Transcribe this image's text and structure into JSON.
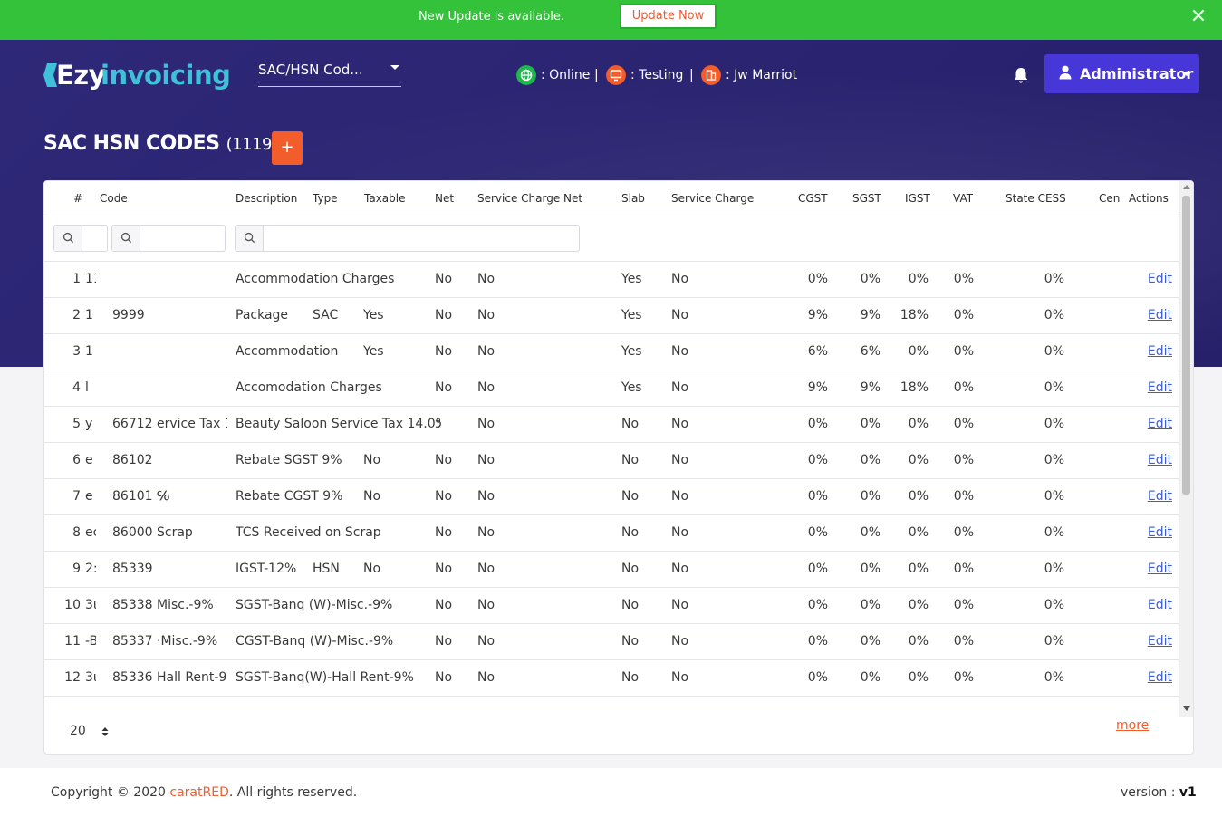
{
  "banner": {
    "message": "New Update is available.",
    "button_label": "Update Now",
    "close_glyph": "✕",
    "close_icon": "close-icon"
  },
  "header": {
    "logo_part1": "Ezy",
    "logo_part2": "invoicing",
    "module_select": "SAC/HSN Cod...",
    "status": [
      {
        "label": ": Online",
        "icon": "globe-icon",
        "color": "#1fb84b"
      },
      {
        "label": ": Testing",
        "icon": "monitor-icon",
        "color": "#f25d2b"
      },
      {
        "label": ": Jw Marriot",
        "icon": "building-icon",
        "color": "#f25d2b"
      }
    ],
    "separator": "|",
    "user_label": "Administrator",
    "bell_icon": "bell-icon"
  },
  "page": {
    "title": "SAC HSN CODES",
    "count": "(1119)",
    "add_glyph": "+"
  },
  "table": {
    "columns": [
      "#",
      "Code",
      "Description",
      "Type",
      "Taxable",
      "Net",
      "Service Charge Net",
      "Slab",
      "Service Charge",
      "CGST",
      "SGST",
      "IGST",
      "VAT",
      "State CESS",
      "Cen",
      "Actions"
    ],
    "rows": [
      {
        "n": "1",
        "a": "11",
        "code": "",
        "name": "",
        "desc": "Accommodation Charges",
        "type": "",
        "taxable": "",
        "net": "No",
        "scn": "No",
        "slab": "Yes",
        "sc": "No",
        "cgst": "0%",
        "sgst": "0%",
        "igst": "0%",
        "vat": "0%",
        "cess": "0%",
        "action": "Edit"
      },
      {
        "n": "2",
        "a": "1",
        "code": "9999",
        "name": "",
        "desc": "Package",
        "type": "SAC",
        "taxable": "Yes",
        "net": "No",
        "scn": "No",
        "slab": "Yes",
        "sc": "No",
        "cgst": "9%",
        "sgst": "9%",
        "igst": "18%",
        "vat": "0%",
        "cess": "0%",
        "action": "Edit"
      },
      {
        "n": "3",
        "a": "1",
        "code": "",
        "name": "",
        "desc": "Accommodation",
        "type": "",
        "taxable": "Yes",
        "net": "No",
        "scn": "No",
        "slab": "Yes",
        "sc": "No",
        "cgst": "6%",
        "sgst": "6%",
        "igst": "0%",
        "vat": "0%",
        "cess": "0%",
        "action": "Edit"
      },
      {
        "n": "4",
        "a": "l",
        "code": "",
        "name": "",
        "desc": "Accomodation Charges",
        "type": "",
        "taxable": "",
        "net": "No",
        "scn": "No",
        "slab": "Yes",
        "sc": "No",
        "cgst": "9%",
        "sgst": "9%",
        "igst": "18%",
        "vat": "0%",
        "cess": "0%",
        "action": "Edit"
      },
      {
        "n": "5",
        "a": "y :",
        "code": "66712",
        "name": "ervice Tax 1",
        "desc": "Beauty Saloon Service Tax 14.0%",
        "type": "",
        "taxable": "",
        "net": "ɔ",
        "scn": "No",
        "slab": "No",
        "sc": "No",
        "cgst": "0%",
        "sgst": "0%",
        "igst": "0%",
        "vat": "0%",
        "cess": "0%",
        "action": "Edit"
      },
      {
        "n": "6",
        "a": "e",
        "code": "86102",
        "name": "",
        "desc": "Rebate SGST 9%",
        "type": "",
        "taxable": "No",
        "net": "No",
        "scn": "No",
        "slab": "No",
        "sc": "No",
        "cgst": "0%",
        "sgst": "0%",
        "igst": "0%",
        "vat": "0%",
        "cess": "0%",
        "action": "Edit"
      },
      {
        "n": "7",
        "a": "e",
        "code": "86101",
        "name": "℅",
        "desc": "Rebate CGST 9%",
        "type": "",
        "taxable": "No",
        "net": "No",
        "scn": "No",
        "slab": "No",
        "sc": "No",
        "cgst": "0%",
        "sgst": "0%",
        "igst": "0%",
        "vat": "0%",
        "cess": "0%",
        "action": "Edit"
      },
      {
        "n": "8",
        "a": "ec",
        "code": "86000",
        "name": "Scrap",
        "desc": "TCS Received on Scrap",
        "type": "",
        "taxable": "",
        "net": "No",
        "scn": "No",
        "slab": "No",
        "sc": "No",
        "cgst": "0%",
        "sgst": "0%",
        "igst": "0%",
        "vat": "0%",
        "cess": "0%",
        "action": "Edit"
      },
      {
        "n": "9",
        "a": "2:",
        "code": "85339",
        "name": "",
        "desc": "IGST-12%",
        "type": "HSN",
        "taxable": "No",
        "net": "No",
        "scn": "No",
        "slab": "No",
        "sc": "No",
        "cgst": "0%",
        "sgst": "0%",
        "igst": "0%",
        "vat": "0%",
        "cess": "0%",
        "action": "Edit"
      },
      {
        "n": "10",
        "a": "3ι",
        "code": "85338",
        "name": "Misc.-9%",
        "desc": "SGST-Banq (W)-Misc.-9%",
        "type": "",
        "taxable": "",
        "net": "No",
        "scn": "No",
        "slab": "No",
        "sc": "No",
        "cgst": "0%",
        "sgst": "0%",
        "igst": "0%",
        "vat": "0%",
        "cess": "0%",
        "action": "Edit"
      },
      {
        "n": "11",
        "a": "-B",
        "code": "85337",
        "name": "·Misc.-9%",
        "desc": "CGST-Banq (W)-Misc.-9%",
        "type": "",
        "taxable": "",
        "net": "No",
        "scn": "No",
        "slab": "No",
        "sc": "No",
        "cgst": "0%",
        "sgst": "0%",
        "igst": "0%",
        "vat": "0%",
        "cess": "0%",
        "action": "Edit"
      },
      {
        "n": "12",
        "a": "3ι",
        "code": "85336",
        "name": "Hall Rent-9",
        "desc": "SGST-Banq(W)-Hall Rent-9%",
        "type": "",
        "taxable": "",
        "net": "No",
        "scn": "No",
        "slab": "No",
        "sc": "No",
        "cgst": "0%",
        "sgst": "0%",
        "igst": "0%",
        "vat": "0%",
        "cess": "0%",
        "action": "Edit"
      }
    ]
  },
  "pagination": {
    "page_size": "20",
    "more_label": "more"
  },
  "footer": {
    "copyright_prefix": "Copyright © 2020 ",
    "brand": "caratRED",
    "copyright_suffix": ". All rights reserved.",
    "version_label": "version : ",
    "version_value": "v1"
  }
}
